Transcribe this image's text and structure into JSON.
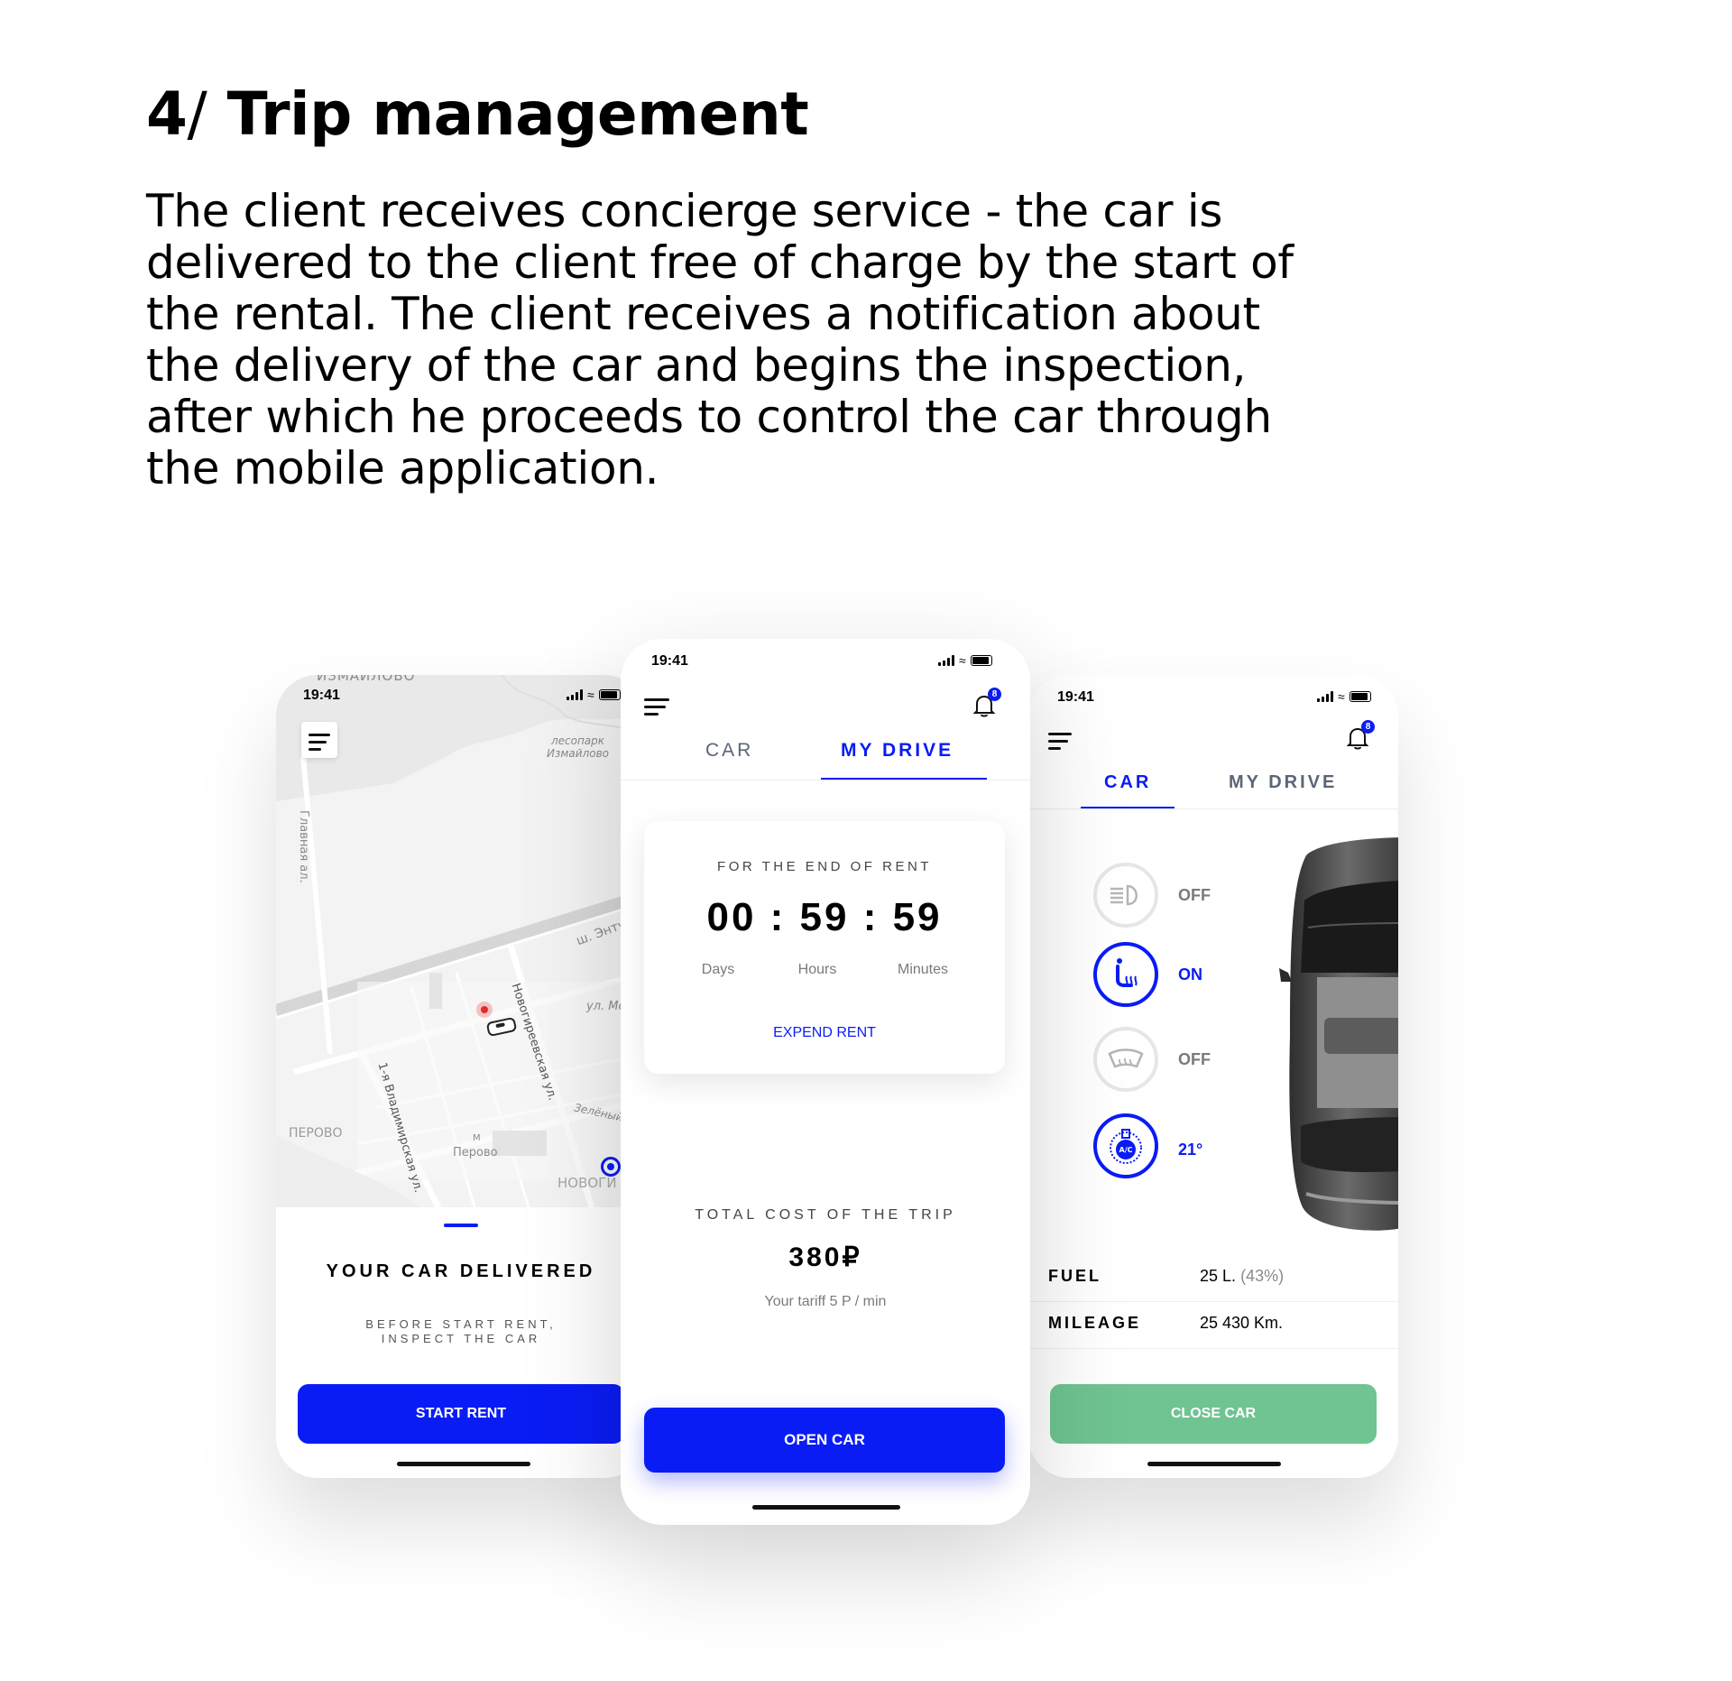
{
  "heading": {
    "number": "4",
    "slash": "/",
    "title": "Trip management"
  },
  "intro": "The client receives concierge service - the car is delivered to the client free of charge by the start of the rental. The client receives a notification about the delivery of the car and begins the inspection, after which he proceeds to control the car through the mobile application.",
  "colors": {
    "accent": "#0a1cf5",
    "green": "#6fc491",
    "muted": "#6b6b6b"
  },
  "left_phone": {
    "time": "19:41",
    "map_labels": {
      "izmailovo": "ИЗМАЙЛОВО",
      "lesopark": "лесопарк\nИзмайлово",
      "glavnaya": "Главная ал.",
      "entuziastov": "ш. Энтузиастов",
      "novogireevskaya": "Новогиреевская ул.",
      "ul_me": "ул. Ме",
      "zeleny": "Зелёный",
      "perovo_district": "ПЕРОВО",
      "metro": "М",
      "perovo_station": "Перово",
      "vladimirskaya": "1-я Владимирская ул.",
      "novo": "НОВОГИ"
    },
    "title": "YOUR CAR DELIVERED",
    "subtitle": "BEFORE START RENT,\nINSPECT THE CAR",
    "button": "START RENT"
  },
  "center_phone": {
    "time": "19:41",
    "badge": "8",
    "tabs": [
      "CAR",
      "MY DRIVE"
    ],
    "timer": {
      "label": "FOR THE END OF RENT",
      "value": "00 : 59 : 59",
      "units": [
        "Days",
        "Hours",
        "Minutes"
      ],
      "link": "EXPEND RENT"
    },
    "cost": {
      "label": "TOTAL COST OF THE TRIP",
      "value": "380₽",
      "tariff": "Your tariff 5 P / min"
    },
    "button": "OPEN CAR"
  },
  "right_phone": {
    "time": "19:41",
    "badge": "8",
    "tabs": [
      "CAR",
      "MY DRIVE"
    ],
    "controls": [
      {
        "icon": "headlight-icon",
        "state": "OFF",
        "active": false
      },
      {
        "icon": "seat-heating-icon",
        "state": "ON",
        "active": true
      },
      {
        "icon": "windshield-heating-icon",
        "state": "OFF",
        "active": false
      },
      {
        "icon": "climate-control-icon",
        "state": "21°",
        "active": true
      }
    ],
    "specs": [
      {
        "label": "FUEL",
        "value": "25 L.",
        "extra": "(43%)"
      },
      {
        "label": "MILEAGE",
        "value": "25 430 Km.",
        "extra": ""
      }
    ],
    "button": "CLOSE CAR"
  }
}
